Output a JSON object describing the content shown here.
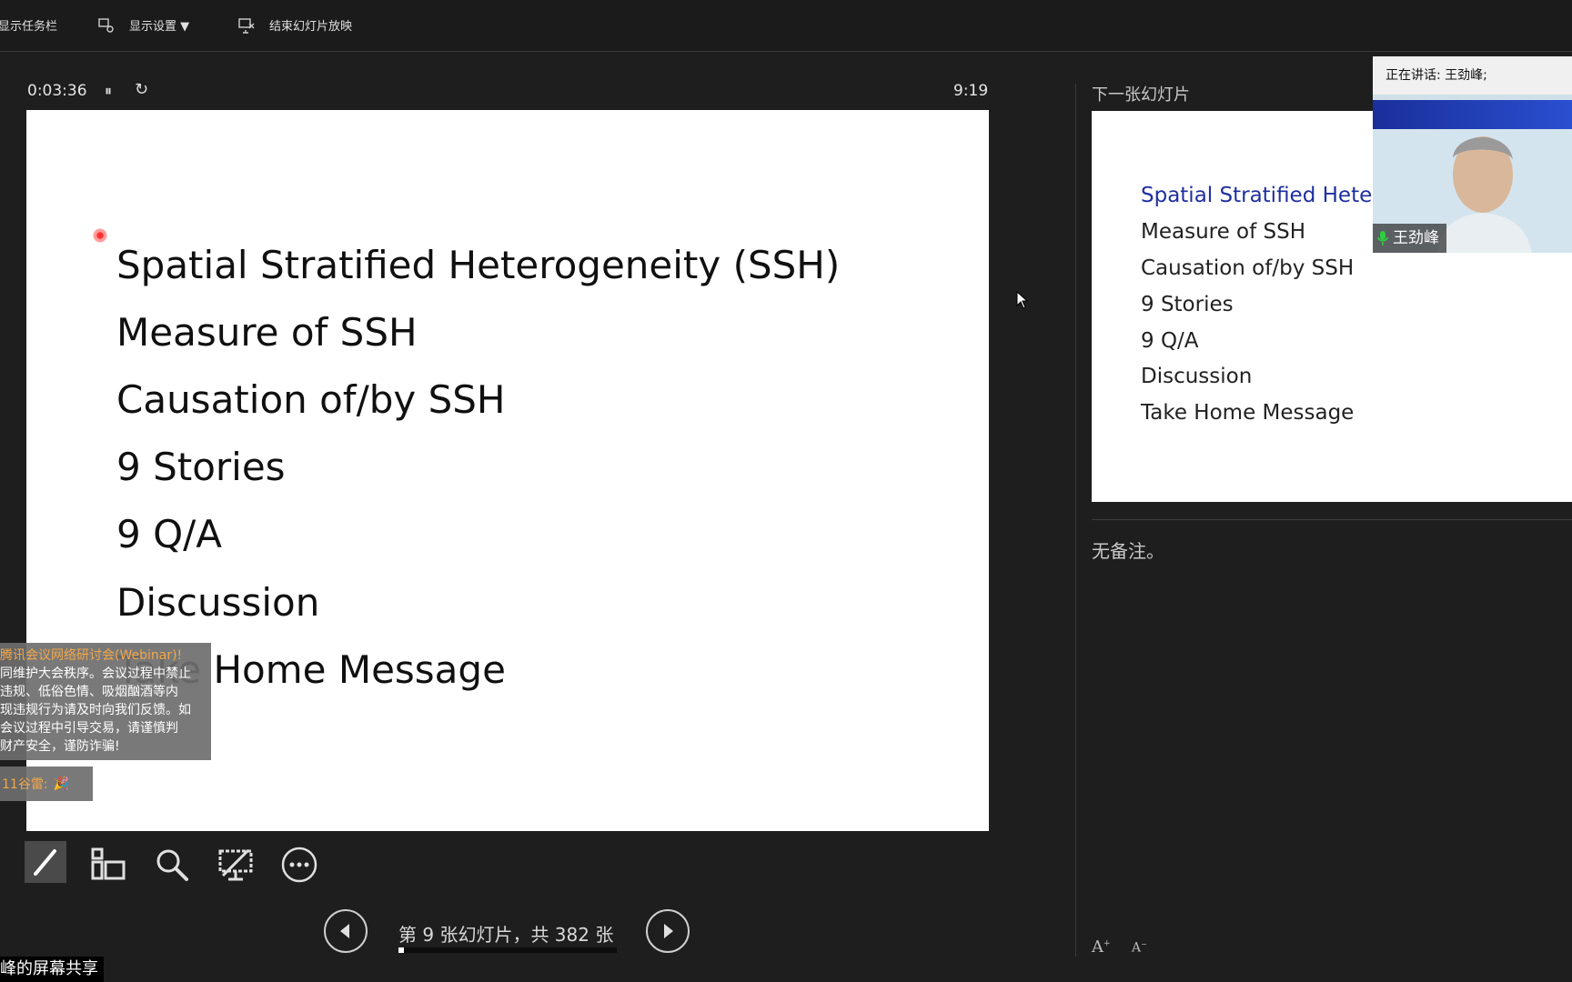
{
  "toolbar": {
    "taskbar_label": "显示任务栏",
    "display_settings_label": "显示设置 ▼",
    "end_show_label": "结束幻灯片放映"
  },
  "presenter": {
    "elapsed_time": "0:03:36",
    "clock": "9:19"
  },
  "current_slide": {
    "lines": [
      "Spatial Stratified Heterogeneity (SSH)",
      "Measure of SSH",
      "Causation of/by SSH",
      "9 Stories",
      "9 Q/A",
      "Discussion",
      "Take Home Message"
    ]
  },
  "notice": {
    "title": "腾讯会议网络研讨会(Webinar)!",
    "lines": [
      "同维护大会秩序。会议过程中禁止",
      "违规、低俗色情、吸烟酗酒等内",
      "现违规行为请及时向我们反馈。如",
      "会议过程中引导交易，请谨慎判",
      "财产安全，谨防诈骗!"
    ]
  },
  "reaction": {
    "text": "11谷雷:",
    "emoji": "🎉"
  },
  "navigation": {
    "counter": "第 9 张幻灯片，共 382 张",
    "progress_fraction": 0.0236
  },
  "share_label": "峰的屏幕共享",
  "next_slide": {
    "label": "下一张幻灯片",
    "lines": [
      "Spatial Stratified Heterogeneity (SSH)",
      "Measure of SSH",
      "Causation of/by SSH",
      "9 Stories",
      "9 Q/A",
      "Discussion",
      "Take Home Message"
    ]
  },
  "notes": {
    "text": "无备注。"
  },
  "speaker": {
    "speaking_label": "正在讲话: 王劲峰;",
    "name": "王劲峰"
  },
  "icons": [
    "display-settings-icon",
    "end-show-icon",
    "pen-icon",
    "slides-grid-icon",
    "zoom-icon",
    "screen-icon",
    "more-icon",
    "prev-icon",
    "next-icon",
    "mic-icon"
  ],
  "colors": {
    "background": "#1e1e1e",
    "notice_title": "#f3a74a",
    "next_title": "#1f2fa0",
    "mic_green": "#2ecc40"
  }
}
